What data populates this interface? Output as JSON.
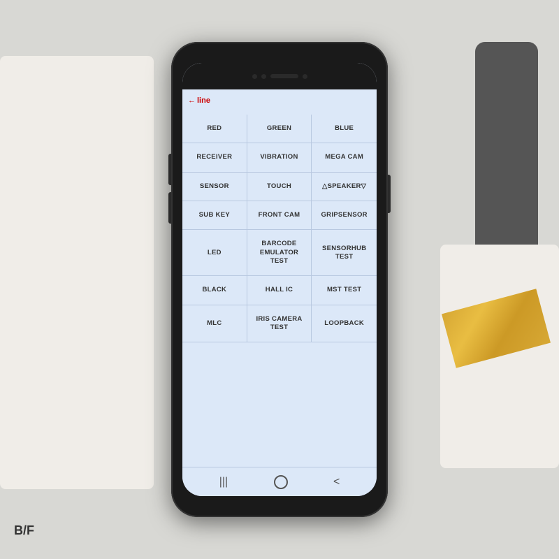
{
  "scene": {
    "bf_label": "B/F"
  },
  "phone": {
    "red_line": {
      "arrow": "←",
      "label": "line"
    },
    "grid": {
      "rows": [
        [
          {
            "text": "RED",
            "id": "red"
          },
          {
            "text": "GREEN",
            "id": "green"
          },
          {
            "text": "BLUE",
            "id": "blue"
          }
        ],
        [
          {
            "text": "RECEIVER",
            "id": "receiver"
          },
          {
            "text": "VIBRATION",
            "id": "vibration"
          },
          {
            "text": "MEGA CAM",
            "id": "mega-cam"
          }
        ],
        [
          {
            "text": "SENSOR",
            "id": "sensor"
          },
          {
            "text": "TOUCH",
            "id": "touch"
          },
          {
            "text": "△SPEAKER▽",
            "id": "speaker"
          }
        ],
        [
          {
            "text": "SUB KEY",
            "id": "sub-key"
          },
          {
            "text": "FRONT CAM",
            "id": "front-cam"
          },
          {
            "text": "GRIPSENSOR",
            "id": "gripsensor"
          }
        ],
        [
          {
            "text": "LED",
            "id": "led"
          },
          {
            "text": "BARCODE\nEMULATOR TEST",
            "id": "barcode-emulator"
          },
          {
            "text": "SENSORHUB TEST",
            "id": "sensorhub-test"
          }
        ],
        [
          {
            "text": "BLACK",
            "id": "black"
          },
          {
            "text": "HALL IC",
            "id": "hall-ic"
          },
          {
            "text": "MST TEST",
            "id": "mst-test"
          }
        ],
        [
          {
            "text": "MLC",
            "id": "mlc"
          },
          {
            "text": "IRIS CAMERA\nTEST",
            "id": "iris-camera"
          },
          {
            "text": "LOOPBACK",
            "id": "loopback"
          }
        ]
      ]
    },
    "nav": {
      "menu": "|||",
      "back": "<"
    }
  }
}
